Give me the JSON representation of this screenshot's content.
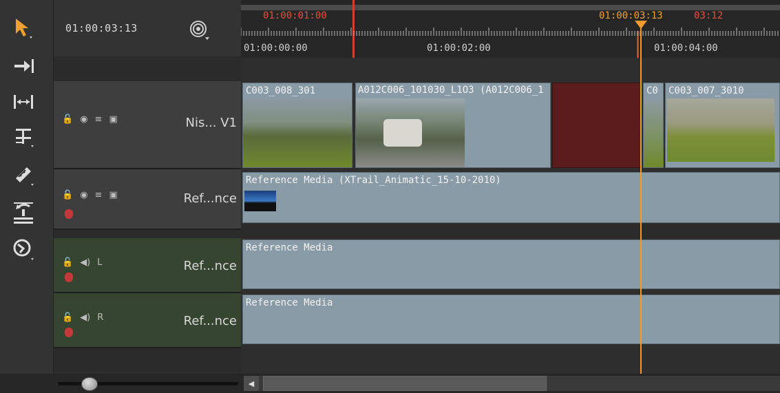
{
  "toolbar": {
    "timecode": "01:00:03:13",
    "tools": [
      "select-tool-icon",
      "track-select-icon",
      "ripple-icon",
      "slip-icon",
      "razor-icon",
      "retime-icon",
      "multitrack-icon"
    ]
  },
  "ruler": {
    "in_marker": "01:00:01:00",
    "playhead_tc": "01:00:03:13",
    "out_marker_tail": "03:12",
    "labels": [
      "01:00:00:00",
      "01:00:02:00",
      "01:00:04:00"
    ]
  },
  "tracks": {
    "video1": {
      "name": "Nis... V1"
    },
    "video2": {
      "name": "Ref...nce"
    },
    "audioL": {
      "name": "Ref...nce",
      "channel": "L"
    },
    "audioR": {
      "name": "Ref...nce",
      "channel": "R"
    }
  },
  "clips": {
    "v1_c1": "C003_008_301",
    "v1_c2": "A012C006_101030_L1O3 (A012C006_1",
    "v1_c3": "C0",
    "v1_c4": "C003_007_3010",
    "v2_c1": "Reference Media (XTrail_Animatic_15-10-2010)",
    "a1_c1": "Reference Media",
    "a2_c1": "Reference Media"
  },
  "colors": {
    "playhead": "#f29a2e",
    "in_marker": "#e2513a",
    "clip": "#8a9ba8",
    "clip_selected": "#5a1c1c",
    "audio_track": "#36452f"
  }
}
